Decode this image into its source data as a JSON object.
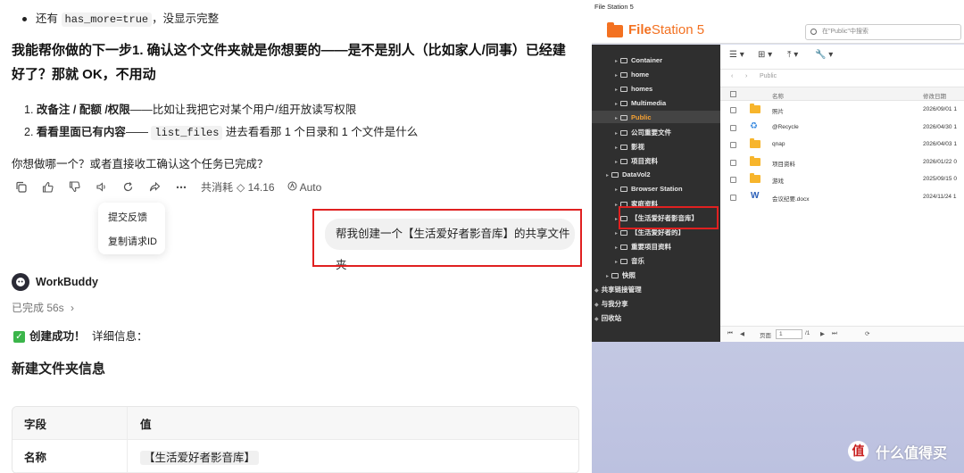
{
  "chat": {
    "bullet_prefix": "还有",
    "bullet_code": "has_more=true",
    "bullet_suffix": "，没显示完整",
    "next_step_line1": "我能帮你做的下一步1. 确认这个文件夹就是你想要的——是不是别人（比如家人/同事）已经建",
    "next_step_line2": "好了？那就 OK，不用动",
    "option1_num": "1.",
    "option1_bold": "改备注 / 配额 /权限",
    "option1_rest": "——比如让我把它对某个用户/组开放读写权限",
    "option2_num": "2.",
    "option2_bold": "看看里面已有内容",
    "option2_mid": "——",
    "option2_code": "list_files",
    "option2_rest": "进去看看那 1 个目录和 1 个文件是什么",
    "question": "你想做哪一个？或者直接收工确认这个任务已完成？",
    "usage_label": "共消耗",
    "usage_value": "◇ 14.16",
    "auto_label": "Auto",
    "menu_feedback": "提交反馈",
    "menu_copy_id": "复制请求ID",
    "user_message": "帮我创建一个【生活爱好者影音库】的共享文件夹",
    "assistant_name": "WorkBuddy",
    "done_status": "已完成 56s",
    "success_label": "创建成功！",
    "success_detail": "详细信息：",
    "section_title": "新建文件夹信息",
    "table_head": [
      "字段",
      "值"
    ],
    "table_rows": [
      {
        "field": "名称",
        "value": "【生活爱好者影音库】"
      }
    ]
  },
  "filestation": {
    "window_title": "File Station 5",
    "logo_bold": "File",
    "logo_rest": "Station 5",
    "search_placeholder": "在\"Public\"中搜索",
    "tree": [
      {
        "label": "Container",
        "level": 2
      },
      {
        "label": "home",
        "level": 2
      },
      {
        "label": "homes",
        "level": 2
      },
      {
        "label": "Multimedia",
        "level": 2
      },
      {
        "label": "Public",
        "level": 2,
        "active": true
      },
      {
        "label": "公司重要文件",
        "level": 2
      },
      {
        "label": "影视",
        "level": 2
      },
      {
        "label": "项目资料",
        "level": 2
      },
      {
        "label": "DataVol2",
        "level": 1
      },
      {
        "label": "Browser Station",
        "level": 2
      },
      {
        "label": "家庭资料",
        "level": 2
      },
      {
        "label": "【生活爱好者影音库】",
        "level": 2
      },
      {
        "label": "【生活爱好者的】",
        "level": 2
      },
      {
        "label": "重要项目资料",
        "level": 2
      },
      {
        "label": "音乐",
        "level": 2
      },
      {
        "label": "快照",
        "level": 1
      },
      {
        "label": "共享链接管理",
        "level": 0
      },
      {
        "label": "与我分享",
        "level": 0
      },
      {
        "label": "回收站",
        "level": 0
      }
    ],
    "path_label": "Public",
    "col_name": "名称",
    "col_date": "修改日期",
    "files": [
      {
        "name": "照片",
        "date": "2026/09/01 1",
        "icon": "folder-icon"
      },
      {
        "name": "@Recycle",
        "date": "2026/04/30 1",
        "icon": "recycle-icon"
      },
      {
        "name": "qnap",
        "date": "2026/04/03 1",
        "icon": "folder-icon"
      },
      {
        "name": "项目资料",
        "date": "2026/01/22 0",
        "icon": "folder-icon"
      },
      {
        "name": "游戏",
        "date": "2025/09/15 0",
        "icon": "folder-icon"
      },
      {
        "name": "会议纪要.docx",
        "date": "2024/11/24 1",
        "icon": "word-doc-icon"
      }
    ],
    "pager_page_label": "页面",
    "pager_page_value": "1",
    "pager_total": "/1"
  },
  "watermark": {
    "text": "什么值得买"
  },
  "colors": {
    "accent_orange": "#f37121",
    "highlight_red": "#e02020",
    "sidebar_bg": "#2f2f2f",
    "folder_yellow": "#f7b52c"
  }
}
